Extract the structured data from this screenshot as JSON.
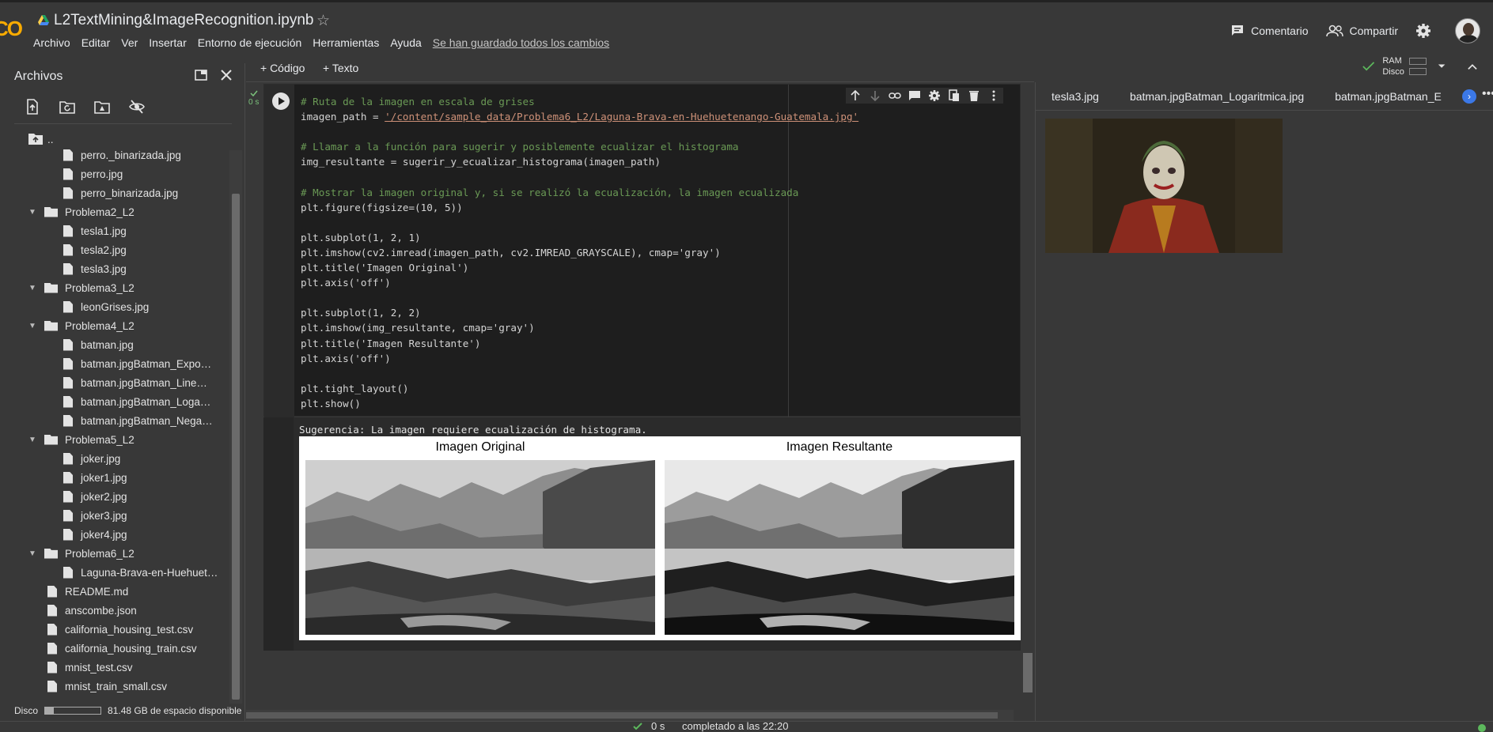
{
  "app": {
    "logo_text": "CO",
    "notebook_title": "L2TextMining&ImageRecognition.ipynb",
    "menu": [
      "Archivo",
      "Editar",
      "Ver",
      "Insertar",
      "Entorno de ejecución",
      "Herramientas",
      "Ayuda"
    ],
    "saved_status": "Se han guardado todos los cambios",
    "comment_label": "Comentario",
    "share_label": "Compartir"
  },
  "files_panel": {
    "title": "Archivos",
    "parent_dir": "..",
    "tree": [
      {
        "name": "perro._binarizada.jpg",
        "kind": "file",
        "level": 2
      },
      {
        "name": "perro.jpg",
        "kind": "file",
        "level": 2
      },
      {
        "name": "perro_binarizada.jpg",
        "kind": "file",
        "level": 2
      },
      {
        "name": "Problema2_L2",
        "kind": "folder",
        "level": 1
      },
      {
        "name": "tesla1.jpg",
        "kind": "file",
        "level": 2
      },
      {
        "name": "tesla2.jpg",
        "kind": "file",
        "level": 2
      },
      {
        "name": "tesla3.jpg",
        "kind": "file",
        "level": 2
      },
      {
        "name": "Problema3_L2",
        "kind": "folder",
        "level": 1
      },
      {
        "name": "leonGrises.jpg",
        "kind": "file",
        "level": 2
      },
      {
        "name": "Problema4_L2",
        "kind": "folder",
        "level": 1
      },
      {
        "name": "batman.jpg",
        "kind": "file",
        "level": 2
      },
      {
        "name": "batman.jpgBatman_Expo…",
        "kind": "file",
        "level": 2
      },
      {
        "name": "batman.jpgBatman_Line…",
        "kind": "file",
        "level": 2
      },
      {
        "name": "batman.jpgBatman_Loga…",
        "kind": "file",
        "level": 2
      },
      {
        "name": "batman.jpgBatman_Nega…",
        "kind": "file",
        "level": 2
      },
      {
        "name": "Problema5_L2",
        "kind": "folder",
        "level": 1
      },
      {
        "name": "joker.jpg",
        "kind": "file",
        "level": 2
      },
      {
        "name": "joker1.jpg",
        "kind": "file",
        "level": 2
      },
      {
        "name": "joker2.jpg",
        "kind": "file",
        "level": 2
      },
      {
        "name": "joker3.jpg",
        "kind": "file",
        "level": 2
      },
      {
        "name": "joker4.jpg",
        "kind": "file",
        "level": 2
      },
      {
        "name": "Problema6_L2",
        "kind": "folder",
        "level": 1
      },
      {
        "name": "Laguna-Brava-en-Huehuet…",
        "kind": "file",
        "level": 2
      },
      {
        "name": "README.md",
        "kind": "file",
        "level": 1
      },
      {
        "name": "anscombe.json",
        "kind": "file",
        "level": 1
      },
      {
        "name": "california_housing_test.csv",
        "kind": "file",
        "level": 1
      },
      {
        "name": "california_housing_train.csv",
        "kind": "file",
        "level": 1
      },
      {
        "name": "mnist_test.csv",
        "kind": "file",
        "level": 1
      },
      {
        "name": "mnist_train_small.csv",
        "kind": "file",
        "level": 1
      }
    ],
    "disk_label": "Disco",
    "disk_used_fraction": 0.15,
    "disk_free": "81.48 GB de espacio disponible"
  },
  "notebook": {
    "add_code": "+ Código",
    "add_text": "+ Texto",
    "ram_label": "RAM",
    "disk_label": "Disco",
    "exec_time": "0 s",
    "code_lines": [
      "# Ruta de la imagen en escala de grises",
      "imagen_path = '/content/sample_data/Problema6_L2/Laguna-Brava-en-Huehuetenango-Guatemala.jpg'",
      "",
      "# Llamar a la función para sugerir y posiblemente ecualizar el histograma",
      "img_resultante = sugerir_y_ecualizar_histograma(imagen_path)",
      "",
      "# Mostrar la imagen original y, si se realizó la ecualización, la imagen ecualizada",
      "plt.figure(figsize=(10, 5))",
      "",
      "plt.subplot(1, 2, 1)",
      "plt.imshow(cv2.imread(imagen_path, cv2.IMREAD_GRAYSCALE), cmap='gray')",
      "plt.title('Imagen Original')",
      "plt.axis('off')",
      "",
      "plt.subplot(1, 2, 2)",
      "plt.imshow(img_resultante, cmap='gray')",
      "plt.title('Imagen Resultante')",
      "plt.axis('off')",
      "",
      "plt.tight_layout()",
      "plt.show()"
    ],
    "output_text": "Sugerencia: La imagen requiere ecualización de histograma.",
    "figure_titles": [
      "Imagen Original",
      "Imagen Resultante"
    ]
  },
  "viewer": {
    "tabs": [
      "tesla3.jpg",
      "batman.jpgBatman_Logaritmica.jpg",
      "batman.jpgBatman_E"
    ]
  },
  "statusbar": {
    "exec_time": "0 s",
    "completed": "completado a las 22:20"
  }
}
